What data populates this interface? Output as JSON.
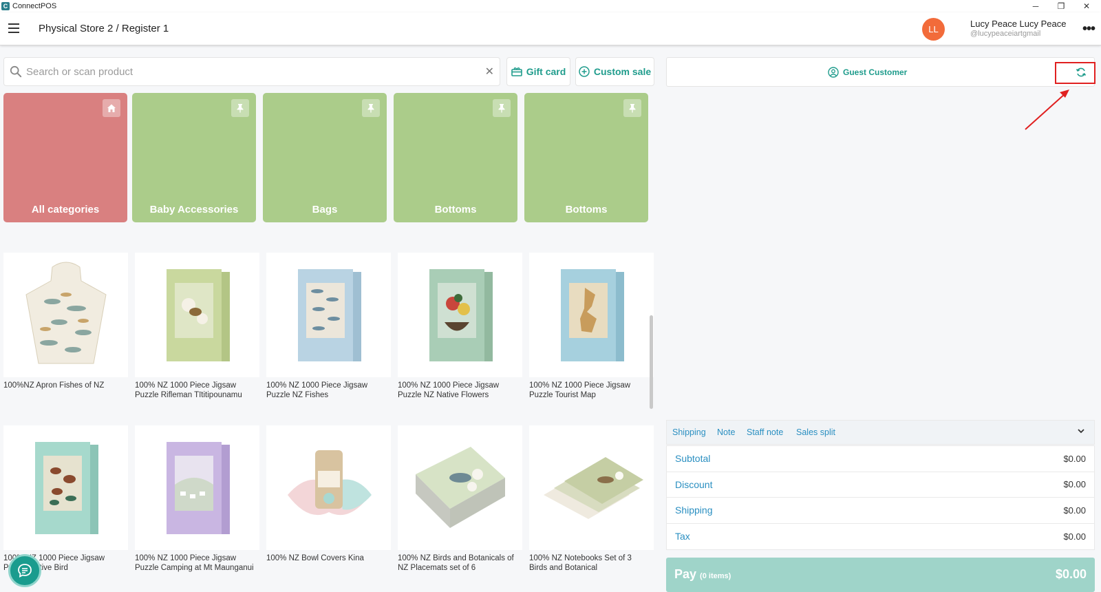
{
  "window": {
    "title": "ConnectPOS",
    "minimize_glyph": "─",
    "restore_glyph": "❐",
    "close_glyph": "✕"
  },
  "header": {
    "title": "Physical Store 2 / Register 1",
    "user_initials": "LL",
    "user_name": "Lucy Peace Lucy Peace",
    "user_handle": "@lucypeaceiartgmail",
    "more_label": "•••"
  },
  "search": {
    "placeholder": "Search or scan product",
    "value": "",
    "clear_glyph": "✕"
  },
  "actions": {
    "gift_card_label": "Gift card",
    "custom_sale_label": "Custom sale"
  },
  "categories": [
    {
      "label": "All categories",
      "icon": "home-icon"
    },
    {
      "label": "Baby Accessories",
      "icon": "pin-icon"
    },
    {
      "label": "Bags",
      "icon": "pin-icon"
    },
    {
      "label": "Bottoms",
      "icon": "pin-icon"
    },
    {
      "label": "Bottoms",
      "icon": "pin-icon"
    }
  ],
  "products": [
    {
      "name": "100%NZ Apron Fishes of NZ"
    },
    {
      "name": "100% NZ 1000 Piece Jigsaw Puzzle Rifleman Tītitipounamu"
    },
    {
      "name": "100% NZ 1000 Piece Jigsaw Puzzle NZ Fishes"
    },
    {
      "name": "100% NZ 1000 Piece Jigsaw Puzzle NZ Native Flowers"
    },
    {
      "name": "100% NZ 1000 Piece Jigsaw Puzzle Tourist Map"
    },
    {
      "name": "100% NZ 1000 Piece Jigsaw Puzzle Native Bird"
    },
    {
      "name": "100% NZ 1000 Piece Jigsaw Puzzle Camping at Mt Maunganui"
    },
    {
      "name": "100% NZ Bowl Covers Kina"
    },
    {
      "name": "100% NZ Birds and Botanicals of NZ Placemats set of 6"
    },
    {
      "name": "100% NZ Notebooks Set of 3 Birds and Botanical"
    }
  ],
  "cart": {
    "customer_label": "Guest Customer",
    "tabs": [
      "Shipping",
      "Note",
      "Staff note",
      "Sales split"
    ],
    "totals": [
      {
        "label": "Subtotal",
        "value": "$0.00"
      },
      {
        "label": "Discount",
        "value": "$0.00"
      },
      {
        "label": "Shipping",
        "value": "$0.00"
      },
      {
        "label": "Tax",
        "value": "$0.00"
      }
    ],
    "pay_label": "Pay",
    "pay_items": "(0 items)",
    "pay_total": "$0.00"
  },
  "colors": {
    "accent": "#1f9c8c",
    "link": "#2a8fc1",
    "category_all": "#d98080",
    "category": "#abcc8a",
    "pay": "#9fd4c9",
    "avatar": "#f26b3a",
    "annotation": "#e02020"
  }
}
